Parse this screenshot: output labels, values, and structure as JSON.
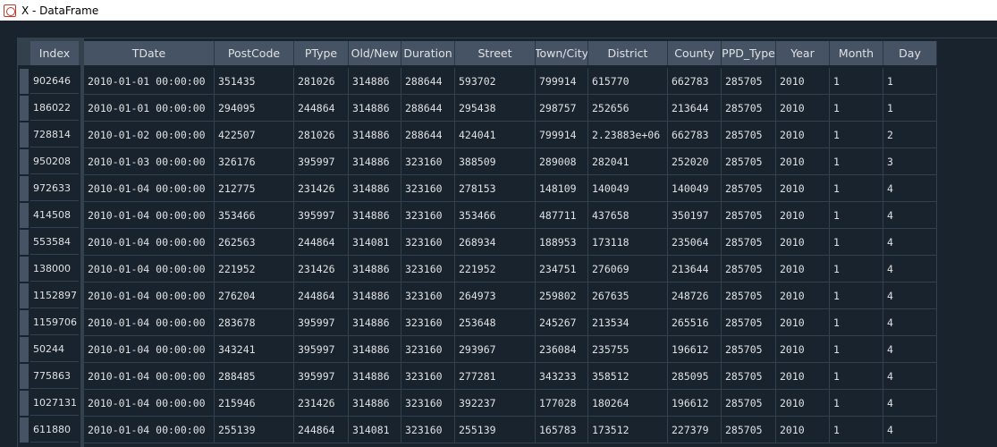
{
  "window": {
    "title": "X - DataFrame"
  },
  "table": {
    "index_header": "Index",
    "columns": [
      "TDate",
      "PostCode",
      "PType",
      "Old/New",
      "Duration",
      "Street",
      "Town/City",
      "District",
      "County",
      "PPD_Type",
      "Year",
      "Month",
      "Day"
    ],
    "rows": [
      {
        "index": "902646",
        "cells": [
          "2010-01-01 00:00:00",
          "351435",
          "281026",
          "314886",
          "288644",
          "593702",
          "799914",
          "615770",
          "662783",
          "285705",
          "2010",
          "1",
          "1"
        ]
      },
      {
        "index": "186022",
        "cells": [
          "2010-01-01 00:00:00",
          "294095",
          "244864",
          "314886",
          "288644",
          "295438",
          "298757",
          "252656",
          "213644",
          "285705",
          "2010",
          "1",
          "1"
        ]
      },
      {
        "index": "728814",
        "cells": [
          "2010-01-02 00:00:00",
          "422507",
          "281026",
          "314886",
          "288644",
          "424041",
          "799914",
          "2.23883e+06",
          "662783",
          "285705",
          "2010",
          "1",
          "2"
        ]
      },
      {
        "index": "950208",
        "cells": [
          "2010-01-03 00:00:00",
          "326176",
          "395997",
          "314886",
          "323160",
          "388509",
          "289008",
          "282041",
          "252020",
          "285705",
          "2010",
          "1",
          "3"
        ]
      },
      {
        "index": "972633",
        "cells": [
          "2010-01-04 00:00:00",
          "212775",
          "231426",
          "314886",
          "323160",
          "278153",
          "148109",
          "140049",
          "140049",
          "285705",
          "2010",
          "1",
          "4"
        ]
      },
      {
        "index": "414508",
        "cells": [
          "2010-01-04 00:00:00",
          "353466",
          "395997",
          "314886",
          "323160",
          "353466",
          "487711",
          "437658",
          "350197",
          "285705",
          "2010",
          "1",
          "4"
        ]
      },
      {
        "index": "553584",
        "cells": [
          "2010-01-04 00:00:00",
          "262563",
          "244864",
          "314081",
          "323160",
          "268934",
          "188953",
          "173118",
          "235064",
          "285705",
          "2010",
          "1",
          "4"
        ]
      },
      {
        "index": "138000",
        "cells": [
          "2010-01-04 00:00:00",
          "221952",
          "231426",
          "314886",
          "323160",
          "221952",
          "234751",
          "276069",
          "213644",
          "285705",
          "2010",
          "1",
          "4"
        ]
      },
      {
        "index": "1152897",
        "cells": [
          "2010-01-04 00:00:00",
          "276204",
          "244864",
          "314886",
          "323160",
          "264973",
          "259802",
          "267635",
          "248726",
          "285705",
          "2010",
          "1",
          "4"
        ]
      },
      {
        "index": "1159706",
        "cells": [
          "2010-01-04 00:00:00",
          "283678",
          "395997",
          "314886",
          "323160",
          "253648",
          "245267",
          "213534",
          "265516",
          "285705",
          "2010",
          "1",
          "4"
        ]
      },
      {
        "index": "50244",
        "cells": [
          "2010-01-04 00:00:00",
          "343241",
          "395997",
          "314886",
          "323160",
          "293967",
          "236084",
          "235755",
          "196612",
          "285705",
          "2010",
          "1",
          "4"
        ]
      },
      {
        "index": "775863",
        "cells": [
          "2010-01-04 00:00:00",
          "288485",
          "395997",
          "314886",
          "323160",
          "277281",
          "343233",
          "358512",
          "285095",
          "285705",
          "2010",
          "1",
          "4"
        ]
      },
      {
        "index": "1027131",
        "cells": [
          "2010-01-04 00:00:00",
          "215946",
          "231426",
          "314886",
          "323160",
          "392237",
          "177028",
          "180264",
          "196612",
          "285705",
          "2010",
          "1",
          "4"
        ]
      },
      {
        "index": "611880",
        "cells": [
          "2010-01-04 00:00:00",
          "255139",
          "244864",
          "314081",
          "323160",
          "255139",
          "165783",
          "173512",
          "227379",
          "285705",
          "2010",
          "1",
          "4"
        ]
      }
    ]
  },
  "colors": {
    "background": "#19232d",
    "header": "#455364",
    "grid": "#32414b",
    "text": "#e0e1e3"
  }
}
